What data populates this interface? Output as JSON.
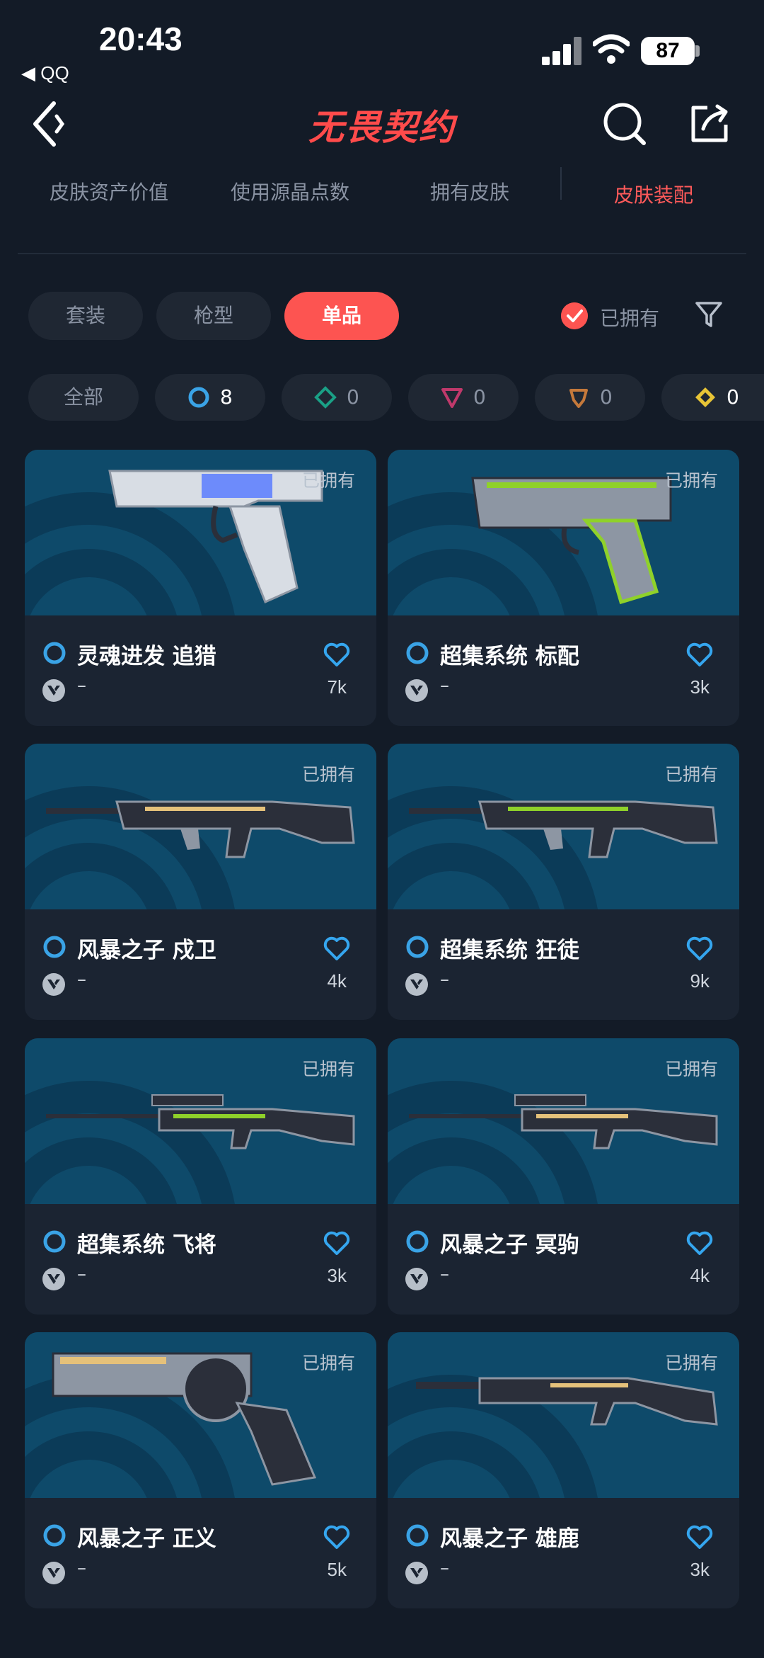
{
  "status_bar": {
    "time": "20:43",
    "back_app": "◀ QQ",
    "battery": "87"
  },
  "header": {
    "logo_text": "无畏契约"
  },
  "tabs": [
    {
      "label": "皮肤资产价值",
      "active": false
    },
    {
      "label": "使用源晶点数",
      "active": false
    },
    {
      "label": "拥有皮肤",
      "active": false
    },
    {
      "label": "皮肤装配",
      "active": true
    }
  ],
  "segments": [
    {
      "label": "套装",
      "active": false
    },
    {
      "label": "枪型",
      "active": false
    },
    {
      "label": "单品",
      "active": true
    }
  ],
  "owned_filter": {
    "label": "已拥有",
    "checked": true
  },
  "rarity_chips": [
    {
      "label": "全部"
    },
    {
      "icon": "ring-icon",
      "color": "#3aa3e6",
      "count": "8"
    },
    {
      "icon": "diamond-icon",
      "color": "#1aa086",
      "count": "0"
    },
    {
      "icon": "triangle-icon",
      "color": "#c0396b",
      "count": "0"
    },
    {
      "icon": "pentagon-icon",
      "color": "#c5793b",
      "count": "0"
    },
    {
      "icon": "gem-icon",
      "color": "#e7c436",
      "count": "0"
    }
  ],
  "owned_tag": "已拥有",
  "skins": [
    {
      "name": "灵魂进发 追猎",
      "sub": "–",
      "likes": "7k",
      "weapon": "pistol-sheriff",
      "accent": "#5a7cff"
    },
    {
      "name": "超集系统 标配",
      "sub": "–",
      "likes": "3k",
      "weapon": "pistol-classic",
      "accent": "#8fd12a"
    },
    {
      "name": "风暴之子 戍卫",
      "sub": "–",
      "likes": "4k",
      "weapon": "rifle-guardian",
      "accent": "#e5c17a"
    },
    {
      "name": "超集系统 狂徒",
      "sub": "–",
      "likes": "9k",
      "weapon": "rifle-vandal",
      "accent": "#8fd12a"
    },
    {
      "name": "超集系统 飞将",
      "sub": "–",
      "likes": "3k",
      "weapon": "sniper-marshal",
      "accent": "#8fd12a"
    },
    {
      "name": "风暴之子 冥驹",
      "sub": "–",
      "likes": "4k",
      "weapon": "sniper-operator",
      "accent": "#e5c17a"
    },
    {
      "name": "风暴之子 正义",
      "sub": "–",
      "likes": "5k",
      "weapon": "revolver-sheriff",
      "accent": "#e5c17a"
    },
    {
      "name": "风暴之子 雄鹿",
      "sub": "–",
      "likes": "3k",
      "weapon": "shotgun-bucky",
      "accent": "#e5c17a"
    }
  ]
}
